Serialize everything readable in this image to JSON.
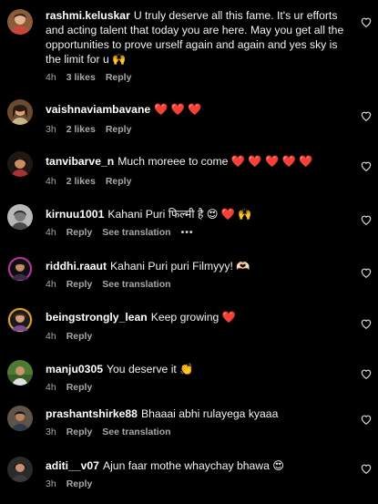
{
  "colors": {
    "background": "#000000",
    "text": "#f2f2f2",
    "meta": "#a8a8a8",
    "heart_red": "#ff2e2e"
  },
  "comments": [
    {
      "username": "rashmi.keluskar",
      "text": "U truly deserve all this fame. It's ur efforts and acting talent that today you are here. May you get all the opportunities to prove urself again and again and yes sky is the limit for u 🙌",
      "time": "4h",
      "likes": "3 likes",
      "reply": "Reply"
    },
    {
      "username": "vaishnaviambavane",
      "text": "❤️ ❤️ ❤️",
      "time": "3h",
      "likes": "2 likes",
      "reply": "Reply"
    },
    {
      "username": "tanvibarve_n",
      "text": "Much moreee to come ❤️ ❤️ ❤️ ❤️ ❤️",
      "time": "4h",
      "likes": "2 likes",
      "reply": "Reply"
    },
    {
      "username": "kirnuu1001",
      "text": "Kahani Puri फिल्मी है 😍 ❤️ 🙌",
      "time": "4h",
      "reply": "Reply",
      "translation": "See translation",
      "more": "•••"
    },
    {
      "username": "riddhi.raaut",
      "text": "Kahani Puri puri Filmyyy! 🫶🏻",
      "time": "4h",
      "reply": "Reply",
      "translation": "See translation"
    },
    {
      "username": "beingstrongly_lean",
      "text": "Keep growing ❤️",
      "time": "4h",
      "reply": "Reply"
    },
    {
      "username": "manju0305",
      "text": "You deserve it 👏",
      "time": "4h",
      "reply": "Reply"
    },
    {
      "username": "prashantshirke88",
      "text": "Bhaaai abhi rulayega kyaaa",
      "time": "3h",
      "reply": "Reply",
      "translation": "See translation"
    },
    {
      "username": "aditi__v07",
      "text": "Ajun faar mothe whaychay bhawa 😍",
      "time": "3h",
      "reply": "Reply"
    }
  ]
}
